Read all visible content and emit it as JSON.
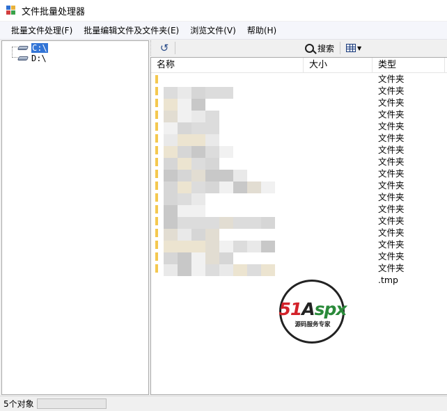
{
  "window": {
    "title": "文件批量处理器",
    "accent_color": "#3375d6"
  },
  "menu": {
    "items": [
      {
        "label": "批量文件处理(F)"
      },
      {
        "label": "批量编辑文件及文件夹(E)"
      },
      {
        "label": "浏览文件(V)"
      },
      {
        "label": "帮助(H)"
      }
    ]
  },
  "tree": {
    "nodes": [
      {
        "label": "C:\\",
        "icon": "drive-icon",
        "selected": true
      },
      {
        "label": "D:\\",
        "icon": "drive-icon",
        "selected": false
      }
    ]
  },
  "toolbar": {
    "undo_icon": "undo-icon",
    "search_label": "搜索",
    "view_icon": "grid-view-icon"
  },
  "listview": {
    "columns": [
      {
        "label": "名称"
      },
      {
        "label": "大小"
      },
      {
        "label": "类型"
      }
    ],
    "rows": [
      {
        "name": "",
        "size": "",
        "type": "文件夹"
      },
      {
        "name": "",
        "size": "",
        "type": "文件夹"
      },
      {
        "name": "",
        "size": "",
        "type": "文件夹"
      },
      {
        "name": "",
        "size": "",
        "type": "文件夹"
      },
      {
        "name": "",
        "size": "",
        "type": "文件夹"
      },
      {
        "name": "",
        "size": "",
        "type": "文件夹"
      },
      {
        "name": "",
        "size": "",
        "type": "文件夹"
      },
      {
        "name": "",
        "size": "",
        "type": "文件夹"
      },
      {
        "name": "",
        "size": "",
        "type": "文件夹"
      },
      {
        "name": "",
        "size": "",
        "type": "文件夹"
      },
      {
        "name": "",
        "size": "",
        "type": "文件夹"
      },
      {
        "name": "",
        "size": "",
        "type": "文件夹"
      },
      {
        "name": "",
        "size": "",
        "type": "文件夹"
      },
      {
        "name": "",
        "size": "",
        "type": "文件夹"
      },
      {
        "name": "",
        "size": "",
        "type": "文件夹"
      },
      {
        "name": "",
        "size": "",
        "type": "文件夹"
      },
      {
        "name": "",
        "size": "",
        "type": "文件夹"
      },
      {
        "name": "",
        "size": "",
        "type": ".tmp"
      }
    ]
  },
  "status": {
    "text": "5个对象",
    "progress": 0
  },
  "watermark": {
    "logo_51": "51",
    "logo_a": "A",
    "logo_spx": "spx",
    "tagline": "源码服务专家"
  }
}
